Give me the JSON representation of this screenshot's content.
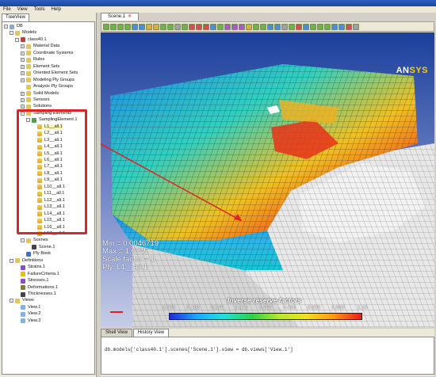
{
  "menubar": {
    "items": [
      "File",
      "View",
      "Tools",
      "Help"
    ]
  },
  "left_panel": {
    "tab_label": "TreeView"
  },
  "tree": {
    "nodes": [
      {
        "label": "DB",
        "depth": 0,
        "icon": "database-icon",
        "expand": "-"
      },
      {
        "label": "Models",
        "depth": 1,
        "icon": "folder-icon",
        "expand": "-"
      },
      {
        "label": "class40.1",
        "depth": 2,
        "icon": "model-icon",
        "expand": "-"
      },
      {
        "label": "Material Data",
        "depth": 3,
        "icon": "folder-icon",
        "expand": "+"
      },
      {
        "label": "Coordinate Systems",
        "depth": 3,
        "icon": "folder-icon",
        "expand": "+"
      },
      {
        "label": "Rules",
        "depth": 3,
        "icon": "folder-icon",
        "expand": "+"
      },
      {
        "label": "Element Sets",
        "depth": 3,
        "icon": "folder-icon",
        "expand": "+"
      },
      {
        "label": "Oriented Element Sets",
        "depth": 3,
        "icon": "folder-icon",
        "expand": "+"
      },
      {
        "label": "Modeling Ply Groups",
        "depth": 3,
        "icon": "folder-icon",
        "expand": "+"
      },
      {
        "label": "Analysis Ply Groups",
        "depth": 3,
        "icon": "folder-icon",
        "expand": ""
      },
      {
        "label": "Solid Models",
        "depth": 3,
        "icon": "folder-icon",
        "expand": "+"
      },
      {
        "label": "Sensors",
        "depth": 3,
        "icon": "folder-icon",
        "expand": "+"
      },
      {
        "label": "Solutions",
        "depth": 3,
        "icon": "folder-icon",
        "expand": "+"
      },
      {
        "label": "Sampling Elements",
        "depth": 3,
        "icon": "folder-icon",
        "expand": "-"
      },
      {
        "label": "SamplingElement.1",
        "depth": 4,
        "icon": "sampling-icon",
        "expand": "-"
      },
      {
        "label": "L1__all.1",
        "depth": 5,
        "icon": "layer-icon",
        "expand": "",
        "selected": true
      },
      {
        "label": "L2__all.1",
        "depth": 5,
        "icon": "layer-icon",
        "expand": ""
      },
      {
        "label": "L3__all.1",
        "depth": 5,
        "icon": "layer-icon",
        "expand": ""
      },
      {
        "label": "L4__all.1",
        "depth": 5,
        "icon": "layer-icon",
        "expand": ""
      },
      {
        "label": "L5__all.1",
        "depth": 5,
        "icon": "layer-icon",
        "expand": ""
      },
      {
        "label": "L6__all.1",
        "depth": 5,
        "icon": "layer-icon",
        "expand": ""
      },
      {
        "label": "L7__all.1",
        "depth": 5,
        "icon": "layer-icon",
        "expand": ""
      },
      {
        "label": "L8__all.1",
        "depth": 5,
        "icon": "layer-icon",
        "expand": ""
      },
      {
        "label": "L9__all.1",
        "depth": 5,
        "icon": "layer-icon",
        "expand": ""
      },
      {
        "label": "L10__all.1",
        "depth": 5,
        "icon": "layer-icon",
        "expand": ""
      },
      {
        "label": "L11__all.1",
        "depth": 5,
        "icon": "layer-icon",
        "expand": ""
      },
      {
        "label": "L12__all.1",
        "depth": 5,
        "icon": "layer-icon",
        "expand": ""
      },
      {
        "label": "L13__all.1",
        "depth": 5,
        "icon": "layer-icon",
        "expand": ""
      },
      {
        "label": "L14__all.1",
        "depth": 5,
        "icon": "layer-icon",
        "expand": ""
      },
      {
        "label": "L15__all.1",
        "depth": 5,
        "icon": "layer-icon",
        "expand": ""
      },
      {
        "label": "L16__all.1",
        "depth": 5,
        "icon": "layer-icon",
        "expand": ""
      },
      {
        "label": "L17__all.1",
        "depth": 5,
        "icon": "layer-icon",
        "expand": ""
      },
      {
        "label": "Scenes",
        "depth": 3,
        "icon": "folder-icon",
        "expand": "-"
      },
      {
        "label": "Scene.1",
        "depth": 4,
        "icon": "scene-icon",
        "expand": ""
      },
      {
        "label": "Ply Book",
        "depth": 3,
        "icon": "plybook-icon",
        "expand": ""
      },
      {
        "label": "Definitions",
        "depth": 1,
        "icon": "folder-icon",
        "expand": "-"
      },
      {
        "label": "Strains.1",
        "depth": 2,
        "icon": "strain-icon",
        "expand": ""
      },
      {
        "label": "FailureCriteria.1",
        "depth": 2,
        "icon": "criteria-icon",
        "expand": ""
      },
      {
        "label": "Stresses.1",
        "depth": 2,
        "icon": "stress-icon",
        "expand": ""
      },
      {
        "label": "Deformations.1",
        "depth": 2,
        "icon": "deformation-icon",
        "expand": ""
      },
      {
        "label": "Thicknesses.1",
        "depth": 2,
        "icon": "thickness-icon",
        "expand": ""
      },
      {
        "label": "Views",
        "depth": 1,
        "icon": "folder-icon",
        "expand": "-"
      },
      {
        "label": "View.1",
        "depth": 2,
        "icon": "view-icon",
        "expand": ""
      },
      {
        "label": "View.2",
        "depth": 2,
        "icon": "view-icon",
        "expand": ""
      },
      {
        "label": "View.3",
        "depth": 2,
        "icon": "view-icon",
        "expand": ""
      }
    ]
  },
  "document": {
    "tab_label": "Scene.1",
    "close_glyph": "✕"
  },
  "viewport": {
    "brand_a": "AN",
    "brand_b": "SYS",
    "stats": {
      "min": "Min = 0.0046719",
      "max": "Max = 1.6345",
      "scale": "Scale factor = 1",
      "ply": "Ply: L1__all.1"
    },
    "legend": {
      "title": "Inverse reserve factors",
      "ticks": [
        "0.000",
        "0.138",
        "0.275",
        "0.413",
        "0.550",
        "0.688",
        "0.825",
        "0.963",
        "1.10"
      ]
    }
  },
  "output": {
    "tabs": [
      "Shell View",
      "History View"
    ],
    "active_tab": "History View",
    "console_line": "db.models['class40.1'].scenes['Scene.1'].view = db.views['View.1']"
  },
  "colors": {
    "highlight_box": "#e02323",
    "title_bar": "#1c45a3"
  }
}
